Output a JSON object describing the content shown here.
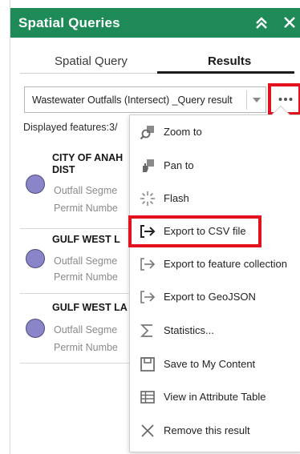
{
  "header": {
    "title": "Spatial Queries"
  },
  "tabs": [
    {
      "label": "Spatial Query"
    },
    {
      "label": "Results"
    }
  ],
  "result_select": {
    "value": "Wastewater Outfalls (Intersect) _Query result"
  },
  "feature_count": "Displayed features:3/",
  "results": [
    {
      "name_line1": "CITY OF ANAH",
      "name_line2": "DIST",
      "field1": "Outfall Segme",
      "field2": "Permit Numbe"
    },
    {
      "name_line1": "GULF WEST L",
      "field1": "Outfall Segme",
      "field2": "Permit Numbe"
    },
    {
      "name_line1": "GULF WEST LA",
      "field1": "Outfall Segme",
      "field2": "Permit Numbe"
    }
  ],
  "menu": {
    "items": [
      {
        "label": "Zoom to",
        "icon": "zoom-to-icon"
      },
      {
        "label": "Pan to",
        "icon": "pan-to-icon"
      },
      {
        "label": "Flash",
        "icon": "flash-icon"
      },
      {
        "label": "Export to CSV file",
        "icon": "export-icon"
      },
      {
        "label": "Export to feature collection",
        "icon": "export-icon"
      },
      {
        "label": "Export to GeoJSON",
        "icon": "export-icon"
      },
      {
        "label": "Statistics...",
        "icon": "sigma-icon"
      },
      {
        "label": "Save to My Content",
        "icon": "save-icon"
      },
      {
        "label": "View in Attribute Table",
        "icon": "table-icon"
      },
      {
        "label": "Remove this result",
        "icon": "close-icon"
      }
    ]
  },
  "colors": {
    "header": "#1d8a57",
    "highlight": "#e3101d",
    "symbol": "#8a84c9"
  }
}
